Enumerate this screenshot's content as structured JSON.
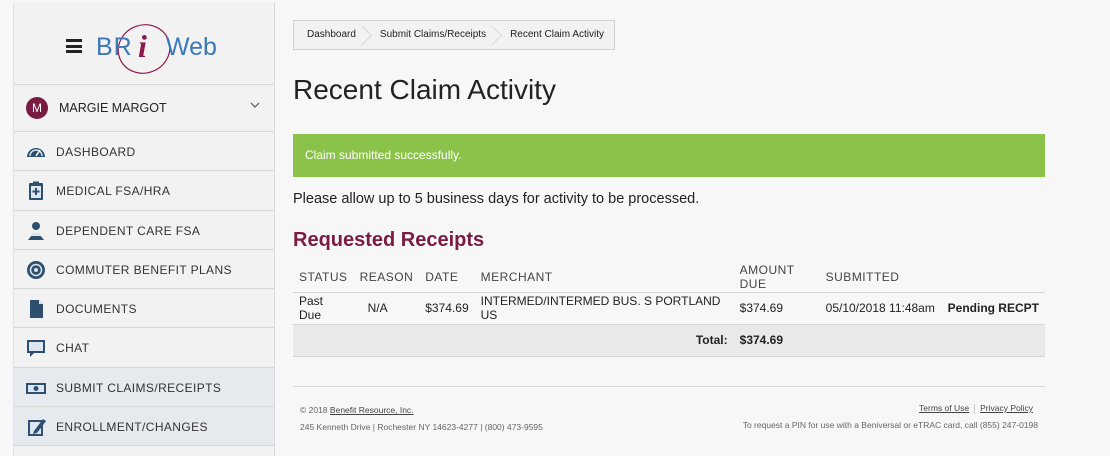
{
  "sidebar": {
    "logo": {
      "part1": "BR",
      "part2": "i",
      "part3": "Web"
    },
    "user": {
      "initial": "M",
      "name": "MARGIE MARGOT"
    },
    "items": [
      {
        "label": "DASHBOARD",
        "icon": "dashboard-gauge-icon"
      },
      {
        "label": "MEDICAL FSA/HRA",
        "icon": "medical-clipboard-icon"
      },
      {
        "label": "DEPENDENT CARE FSA",
        "icon": "dependent-person-icon"
      },
      {
        "label": "COMMUTER BENEFIT PLANS",
        "icon": "commuter-icon"
      },
      {
        "label": "DOCUMENTS",
        "icon": "document-icon"
      },
      {
        "label": "CHAT",
        "icon": "chat-icon"
      },
      {
        "label": "SUBMIT CLAIMS/RECEIPTS",
        "icon": "money-icon"
      },
      {
        "label": "ENROLLMENT/CHANGES",
        "icon": "edit-icon"
      }
    ]
  },
  "breadcrumb": [
    "Dashboard",
    "Submit Claims/Receipts",
    "Recent Claim Activity"
  ],
  "page_title": "Recent Claim Activity",
  "alert": "Claim submitted successfully.",
  "notice": "Please allow up to 5 business days for activity to be processed.",
  "section_title": "Requested Receipts",
  "table": {
    "headers": [
      "STATUS",
      "REASON",
      "DATE",
      "MERCHANT",
      "AMOUNT DUE",
      "SUBMITTED",
      ""
    ],
    "rows": [
      [
        "Past Due",
        "N/A",
        "$374.69",
        "INTERMED/INTERMED BUS. S PORTLAND US",
        "$374.69",
        "05/10/2018 11:48am",
        "Pending RECPT"
      ]
    ],
    "total_label": "Total:",
    "total_value": "$374.69"
  },
  "footer": {
    "copyright_prefix": "© 2018",
    "company": "Benefit Resource, Inc.",
    "address": "245 Kenneth Drive | Rochester NY 14623-4277 | (800) 473-9595",
    "terms": "Terms of Use",
    "privacy": "Privacy Policy",
    "pin_note": "To request a PIN for use with a Beniversal or eTRAC card, call (855) 247-0198"
  },
  "colors": {
    "brand_maroon": "#7a1b44",
    "brand_blue": "#3a78b7",
    "success_green": "#8bc34a"
  }
}
